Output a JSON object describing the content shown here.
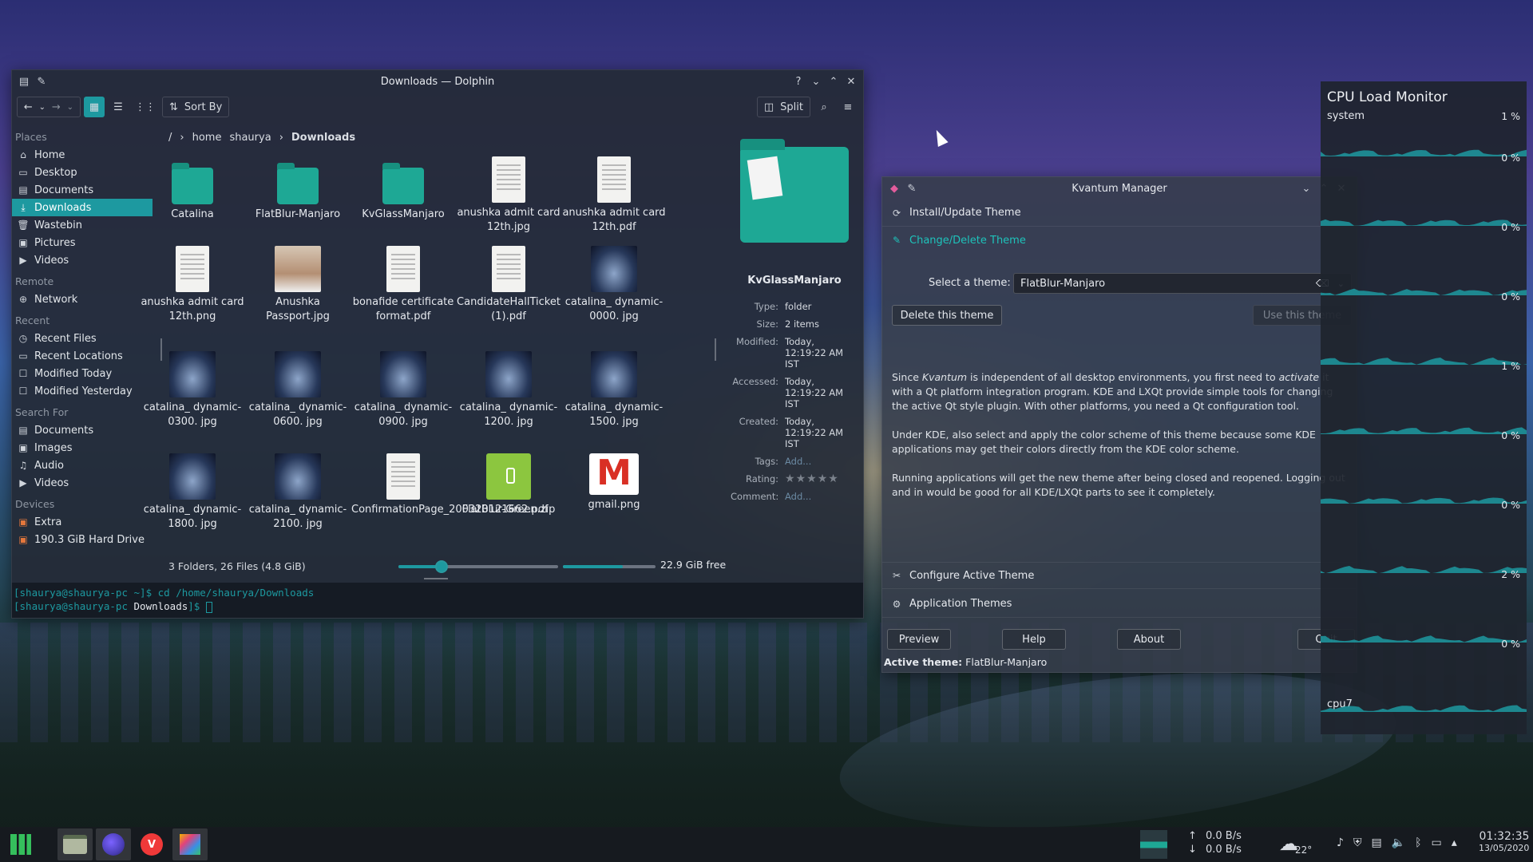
{
  "dolphin": {
    "title": "Downloads — Dolphin",
    "toolbar": {
      "sort_by": "Sort By",
      "split": "Split"
    },
    "places_header": "Places",
    "places": [
      "Home",
      "Desktop",
      "Documents",
      "Downloads",
      "Wastebin",
      "Pictures",
      "Videos"
    ],
    "remote_header": "Remote",
    "remote": [
      "Network"
    ],
    "recent_header": "Recent",
    "recent": [
      "Recent Files",
      "Recent Locations",
      "Modified Today",
      "Modified Yesterday"
    ],
    "search_header": "Search For",
    "search": [
      "Documents",
      "Images",
      "Audio",
      "Videos"
    ],
    "devices_header": "Devices",
    "devices": [
      "Extra",
      "190.3 GiB Hard Drive"
    ],
    "breadcrumb": {
      "root": "/",
      "home": "home",
      "user": "shaurya",
      "current": "Downloads"
    },
    "files": [
      {
        "name": "Catalina",
        "kind": "folder"
      },
      {
        "name": "FlatBlur-Manjaro",
        "kind": "folder"
      },
      {
        "name": "KvGlassManjaro",
        "kind": "folder"
      },
      {
        "name": "anushka admit card 12th.jpg",
        "kind": "doc"
      },
      {
        "name": "anushka admit card 12th.pdf",
        "kind": "doc"
      },
      {
        "name": "anushka admit card 12th.png",
        "kind": "doc"
      },
      {
        "name": "Anushka Passport.jpg",
        "kind": "person"
      },
      {
        "name": "bonafide certificate format.pdf",
        "kind": "doc"
      },
      {
        "name": "CandidateHallTicket (1).pdf",
        "kind": "doc"
      },
      {
        "name": "catalina_ dynamic-0000. jpg",
        "kind": "photo"
      },
      {
        "name": "catalina_ dynamic-0300. jpg",
        "kind": "photo"
      },
      {
        "name": "catalina_ dynamic-0600. jpg",
        "kind": "photo"
      },
      {
        "name": "catalina_ dynamic-0900. jpg",
        "kind": "photo"
      },
      {
        "name": "catalina_ dynamic-1200. jpg",
        "kind": "photo"
      },
      {
        "name": "catalina_ dynamic-1500. jpg",
        "kind": "photo"
      },
      {
        "name": "catalina_ dynamic-1800. jpg",
        "kind": "photo"
      },
      {
        "name": "catalina_ dynamic-2100. jpg",
        "kind": "photo"
      },
      {
        "name": "ConfirmationPage_200320121662.pdf",
        "kind": "doc"
      },
      {
        "name": "FlatBlur-Green.zip",
        "kind": "zip"
      },
      {
        "name": "gmail.png",
        "kind": "gmail"
      }
    ],
    "info": {
      "name": "KvGlassManjaro",
      "type_label": "Type:",
      "type": "folder",
      "size_label": "Size:",
      "size": "2 items",
      "modified_label": "Modified:",
      "modified": "Today, 12:19:22 AM IST",
      "accessed_label": "Accessed:",
      "accessed": "Today, 12:19:22 AM IST",
      "created_label": "Created:",
      "created": "Today, 12:19:22 AM IST",
      "tags_label": "Tags:",
      "tags": "Add...",
      "rating_label": "Rating:",
      "rating": 0,
      "rating_max": 5,
      "comment_label": "Comment:",
      "comment": "Add..."
    },
    "status": "3 Folders, 26 Files (4.8 GiB)",
    "zoom_fraction": 0.27,
    "disk_used_fraction": 0.65,
    "free_space": "22.9 GiB free",
    "terminal": {
      "line1_prompt": "[shaurya@shaurya-pc ~]$",
      "line1_cmd": " cd /home/shaurya/Downloads",
      "line2_prompt_a": "[shaurya@shaurya-pc ",
      "line2_dir": "Downloads",
      "line2_prompt_b": "]$"
    }
  },
  "kvantum": {
    "title": "Kvantum Manager",
    "sections": {
      "install": "Install/Update Theme",
      "change": "Change/Delete Theme",
      "configure": "Configure Active Theme",
      "app_themes": "Application Themes"
    },
    "select_label": "Select a theme:",
    "selected_theme": "FlatBlur-Manjaro",
    "delete_button": "Delete this theme",
    "use_button": "Use this theme",
    "para1_a": "Since ",
    "para1_em1": "Kvantum",
    "para1_b": " is independent of all desktop environments, you first need to ",
    "para1_em2": "activate",
    "para1_c": " it with a Qt platform integration program. KDE and LXQt provide simple tools for changing the active Qt style plugin. With other platforms, you need a Qt configuration tool.",
    "para2": "Under KDE, also select and apply the color scheme of this theme because some KDE applications may get their colors directly from the KDE color scheme.",
    "para3": "Running applications will get the new theme after being closed and reopened. Logging out and in would be good for all KDE/LXQt parts to see it completely.",
    "buttons": {
      "preview": "Preview",
      "help": "Help",
      "about": "About",
      "quit": "Quit"
    },
    "active_label": "Active theme:",
    "active_value": "FlatBlur-Manjaro"
  },
  "cpu": {
    "title": "CPU Load Monitor",
    "rows": [
      {
        "label": "system",
        "pct": "1 %"
      },
      {
        "label": "",
        "pct": "0 %"
      },
      {
        "label": "",
        "pct": "0 %"
      },
      {
        "label": "",
        "pct": "0 %"
      },
      {
        "label": "",
        "pct": "1 %"
      },
      {
        "label": "",
        "pct": "0 %"
      },
      {
        "label": "",
        "pct": "0 %"
      },
      {
        "label": "",
        "pct": "2 %"
      },
      {
        "label": "cpu7",
        "pct": "0 %"
      }
    ]
  },
  "taskbar": {
    "net_up": "0.0 B/s",
    "net_down": "0.0 B/s",
    "weather_temp": "22°",
    "time": "01:32:35",
    "date": "13/05/2020"
  },
  "colors": {
    "accent": "#1d99a0",
    "kvantum_active": "#1ec3bb",
    "folder": "#1ea895"
  }
}
